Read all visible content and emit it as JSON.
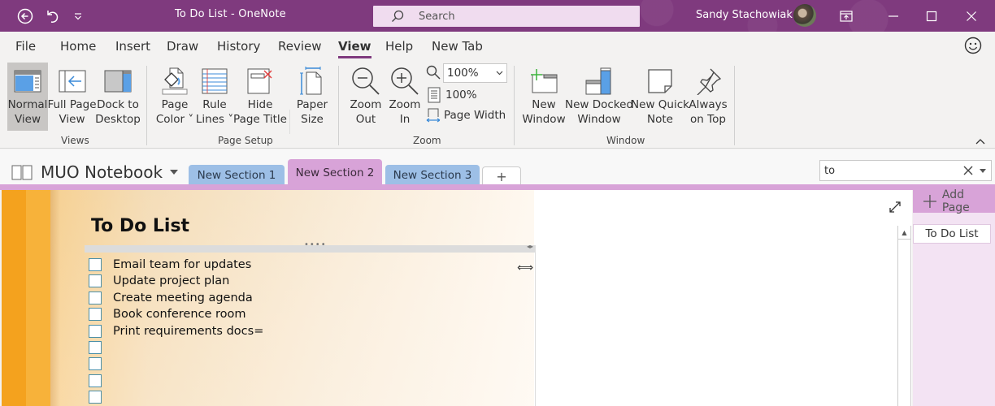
{
  "titlebar": {
    "title": "To Do List  -  OneNote",
    "search_placeholder": "Search",
    "user_name": "Sandy Stachowiak"
  },
  "ribbon_tabs": [
    "File",
    "Home",
    "Insert",
    "Draw",
    "History",
    "Review",
    "View",
    "Help",
    "New Tab"
  ],
  "active_tab": "View",
  "ribbon": {
    "views": {
      "label": "Views",
      "buttons": [
        {
          "line1": "Normal",
          "line2": "View"
        },
        {
          "line1": "Full Page",
          "line2": "View"
        },
        {
          "line1": "Dock to",
          "line2": "Desktop"
        }
      ]
    },
    "page_setup": {
      "label": "Page Setup",
      "buttons": [
        {
          "line1": "Page",
          "line2": "Color ˅"
        },
        {
          "line1": "Rule",
          "line2": "Lines ˅"
        },
        {
          "line1": "Hide",
          "line2": "Page Title"
        },
        {
          "line1": "Paper",
          "line2": "Size"
        }
      ]
    },
    "zoom": {
      "label": "Zoom",
      "zoom_out": {
        "line1": "Zoom",
        "line2": "Out"
      },
      "zoom_in": {
        "line1": "Zoom",
        "line2": "In"
      },
      "zoom_value": "100%",
      "hundred_percent": "100%",
      "page_width": "Page Width"
    },
    "window": {
      "label": "Window",
      "buttons": [
        {
          "line1": "New",
          "line2": "Window"
        },
        {
          "line1": "New Docked",
          "line2": "Window"
        },
        {
          "line1": "New Quick",
          "line2": "Note"
        },
        {
          "line1": "Always",
          "line2": "on Top"
        }
      ]
    }
  },
  "notebook": {
    "name": "MUO Notebook",
    "sections": [
      {
        "label": "New Section 1",
        "color": "#9dbfe6"
      },
      {
        "label": "New Section 2",
        "color": "#d8a3d8",
        "active": true
      },
      {
        "label": "New Section 3",
        "color": "#9dbfe6"
      }
    ],
    "add_section": "+",
    "search_value": "to"
  },
  "page": {
    "title": "To Do List",
    "todos": [
      {
        "text": "Email team for updates",
        "checked": false
      },
      {
        "text": "Update project plan",
        "checked": false
      },
      {
        "text": "Create meeting agenda",
        "checked": false
      },
      {
        "text": "Book conference room",
        "checked": false
      },
      {
        "text": "Print requirements docs=",
        "checked": false
      },
      {
        "text": "",
        "checked": false
      },
      {
        "text": "",
        "checked": false
      },
      {
        "text": "",
        "checked": false
      },
      {
        "text": "",
        "checked": false
      }
    ]
  },
  "pages_panel": {
    "add_page": "Add Page",
    "pages": [
      "To Do List"
    ]
  },
  "colors": {
    "brand": "#7f3a7e",
    "section_pink": "#d8a3d8",
    "section_blue": "#9dbfe6"
  }
}
